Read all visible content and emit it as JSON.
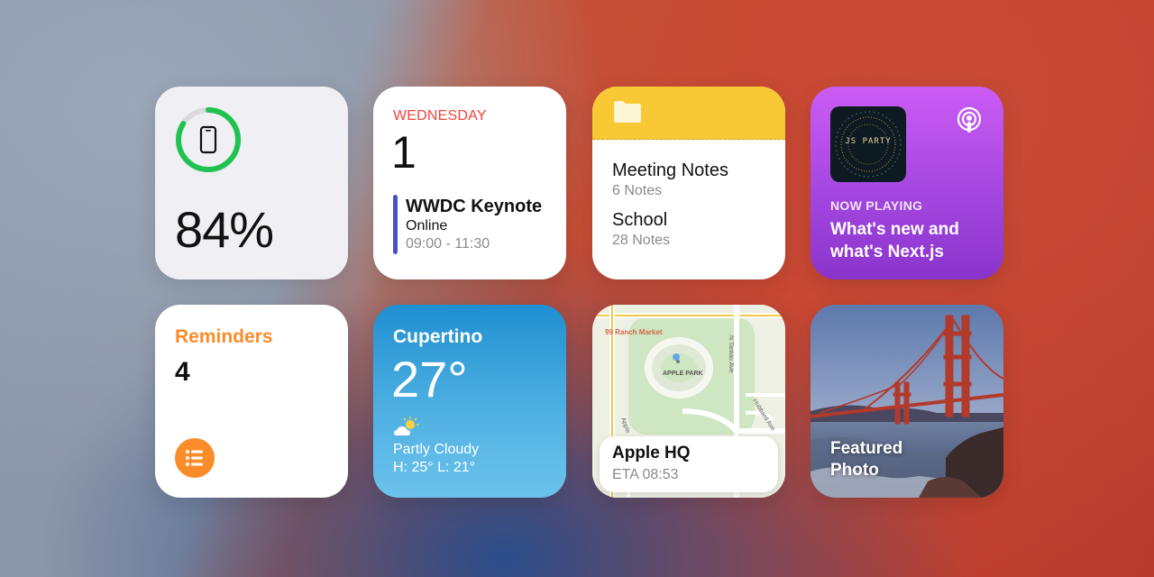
{
  "battery": {
    "percent_label": "84%",
    "level": 0.84,
    "ring_color": "#20c250",
    "icon": "iphone-icon"
  },
  "calendar": {
    "weekday": "WEDNESDAY",
    "date": "1",
    "event": {
      "title": "WWDC Keynote",
      "location": "Online",
      "time": "09:00 - 11:30",
      "color": "#4354c8"
    },
    "accent": "#f0443a"
  },
  "notes": {
    "icon": "folder-icon",
    "header_color": "#f8c934",
    "folders": [
      {
        "name": "Meeting Notes",
        "count": "6 Notes"
      },
      {
        "name": "School",
        "count": "28 Notes"
      }
    ]
  },
  "podcast": {
    "artwork_label": "JS PARTY",
    "status": "NOW PLAYING",
    "title": "What's new and what's Next.js",
    "icon": "podcasts-icon"
  },
  "reminders": {
    "title": "Reminders",
    "count": "4",
    "accent": "#fb8c2a",
    "icon": "list-icon"
  },
  "weather": {
    "city": "Cupertino",
    "temperature": "27°",
    "condition": "Partly Cloudy",
    "high_low": "H: 25° L: 21°",
    "icon": "partly-cloudy-icon"
  },
  "map": {
    "labels": {
      "market": "99 Ranch Market",
      "park": "APPLE PARK",
      "street1": "N Tantau Ave",
      "street2": "Hubbard Ave",
      "street3": "Apple"
    },
    "destination": "Apple HQ",
    "eta": "ETA 08:53"
  },
  "photo": {
    "caption": "Featured Photo"
  }
}
